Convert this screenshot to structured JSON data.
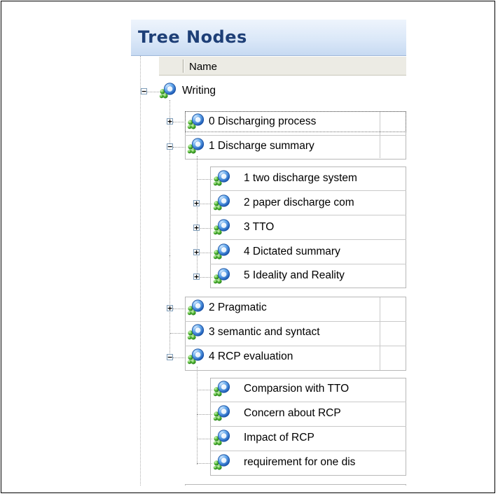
{
  "panel": {
    "title": "Tree Nodes",
    "column_header": "Name"
  },
  "tree": {
    "root": {
      "label": "Writing",
      "state": "expanded"
    },
    "nodes": [
      {
        "label": "0 Discharging process",
        "state": "collapsed",
        "selected": true
      },
      {
        "label": "1 Discharge summary",
        "state": "expanded"
      },
      {
        "label": "1 two discharge system",
        "state": "leaf"
      },
      {
        "label": "2 paper discharge com",
        "state": "collapsed"
      },
      {
        "label": "3 TTO",
        "state": "collapsed"
      },
      {
        "label": "4 Dictated summary",
        "state": "collapsed"
      },
      {
        "label": "5 Ideality and Reality",
        "state": "collapsed"
      },
      {
        "label": "2 Pragmatic",
        "state": "collapsed"
      },
      {
        "label": "3 semantic and syntact",
        "state": "leaf"
      },
      {
        "label": "4 RCP evaluation",
        "state": "expanded"
      },
      {
        "label": "Comparsion with TTO",
        "state": "leaf"
      },
      {
        "label": "Concern about RCP",
        "state": "leaf"
      },
      {
        "label": "Impact of RCP",
        "state": "leaf"
      },
      {
        "label": "requirement for one dis",
        "state": "leaf"
      }
    ]
  },
  "icons": {
    "node": "node-icon",
    "expand": "plus-expander-icon",
    "collapse": "minus-expander-icon"
  },
  "colors": {
    "title_text": "#1e3f77",
    "title_bg": "#dbe8f8",
    "header_bg": "#ecebe4",
    "node_blue": "#3f7fd8",
    "node_green": "#3e9b2e"
  },
  "glyphs": {
    "plus": "+",
    "minus": "−"
  }
}
